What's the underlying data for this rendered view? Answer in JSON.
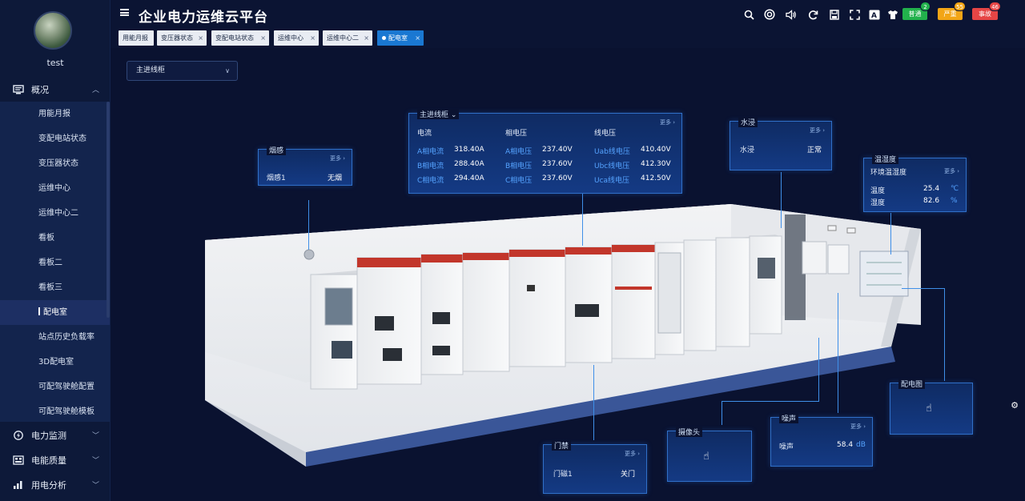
{
  "user": {
    "name": "test"
  },
  "sidebar": {
    "top_group": {
      "label": "概况",
      "icon": "monitor-icon"
    },
    "items": [
      "用能月报",
      "变配电站状态",
      "变压器状态",
      "运维中心",
      "运维中心二",
      "看板",
      "看板二",
      "看板三",
      "配电室",
      "站点历史负载率",
      "3D配电室",
      "可配驾驶舱配置",
      "可配驾驶舱模板"
    ],
    "active_index": 8,
    "groups": [
      {
        "label": "电力监测",
        "icon": "lightning-circle-icon"
      },
      {
        "label": "电能质量",
        "icon": "grid-icon"
      },
      {
        "label": "用电分析",
        "icon": "bar-chart-icon"
      }
    ]
  },
  "header": {
    "title": "企业电力运维云平台",
    "alerts": [
      {
        "label": "普通",
        "count": "2",
        "color": "#22b14c"
      },
      {
        "label": "严重",
        "count": "55",
        "color": "#f2a516"
      },
      {
        "label": "事故",
        "count": "46",
        "color": "#e64545"
      }
    ]
  },
  "tabs": [
    {
      "label": "用能月报",
      "closable": false
    },
    {
      "label": "变压器状态",
      "closable": true
    },
    {
      "label": "变配电站状态",
      "closable": true
    },
    {
      "label": "运维中心",
      "closable": true
    },
    {
      "label": "运维中心二",
      "closable": true
    },
    {
      "label": "配电室",
      "closable": true,
      "active": true
    }
  ],
  "main": {
    "selector": {
      "value": "主进线柜"
    },
    "more_label": "更多",
    "panels": {
      "incoming": {
        "title": "主进线柜",
        "col1": {
          "header": "电流",
          "rows": [
            [
              "A相电流",
              "318.40A"
            ],
            [
              "B相电流",
              "288.40A"
            ],
            [
              "C相电流",
              "294.40A"
            ]
          ]
        },
        "col2": {
          "header": "相电压",
          "rows": [
            [
              "A相电压",
              "237.40V"
            ],
            [
              "B相电压",
              "237.60V"
            ],
            [
              "C相电压",
              "237.60V"
            ]
          ]
        },
        "col3": {
          "header": "线电压",
          "rows": [
            [
              "Uab线电压",
              "410.40V"
            ],
            [
              "Ubc线电压",
              "412.30V"
            ],
            [
              "Uca线电压",
              "412.50V"
            ]
          ]
        }
      },
      "smoke": {
        "title": "烟感",
        "label": "烟感1",
        "value": "无烟"
      },
      "water": {
        "title": "水浸",
        "label": "水浸",
        "value": "正常"
      },
      "temp_humidity": {
        "title": "温湿度",
        "subtitle": "环境温湿度",
        "rows": [
          {
            "label": "温度",
            "value": "25.4",
            "unit": "℃"
          },
          {
            "label": "湿度",
            "value": "82.6",
            "unit": "%"
          }
        ]
      },
      "diagram": {
        "title": "配电图"
      },
      "noise": {
        "title": "噪声",
        "label": "噪声",
        "value": "58.4",
        "unit": "dB"
      },
      "camera": {
        "title": "摄像头"
      },
      "door": {
        "title": "门禁",
        "label": "门磁1",
        "value": "关门"
      }
    }
  }
}
